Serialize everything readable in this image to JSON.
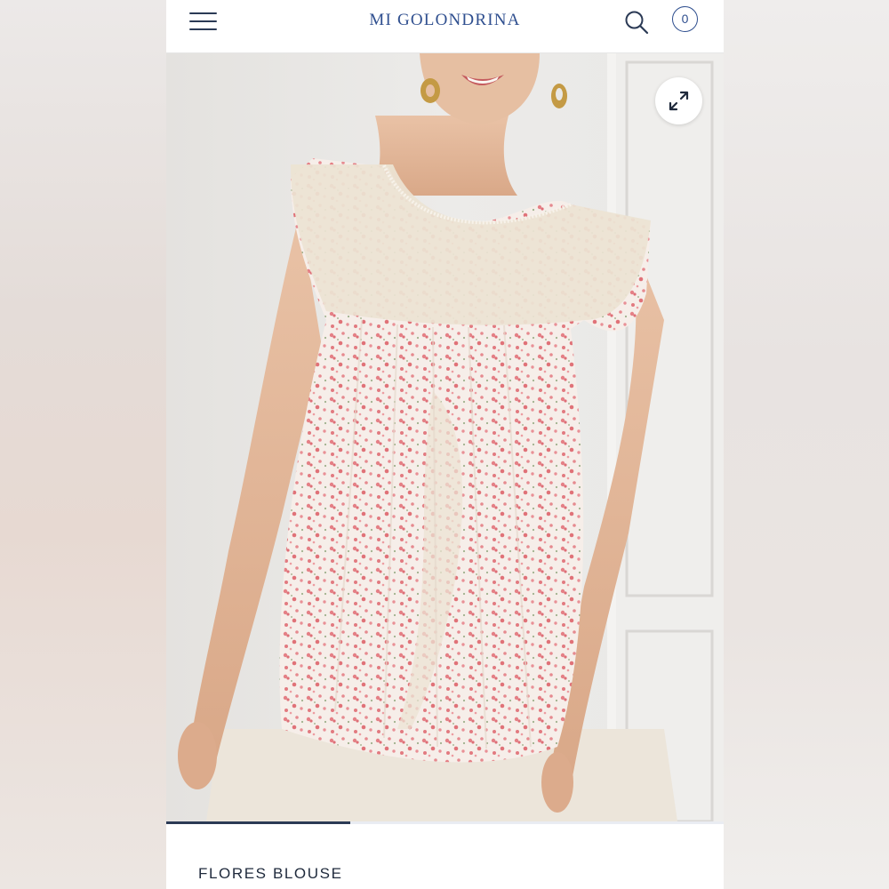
{
  "header": {
    "brand": "MI GOLONDRINA",
    "cart_count": "0",
    "icons": {
      "menu": "hamburger-menu-icon",
      "search": "search-icon",
      "cart": "cart-count-badge",
      "expand": "expand-arrows-icon"
    }
  },
  "gallery": {
    "progress_fraction": 0.33
  },
  "product": {
    "title": "FLORES BLOUSE"
  },
  "colors": {
    "brand": "#2f4f8f",
    "ink": "#1f2a3c",
    "blouse_pink": "#e07c82"
  }
}
